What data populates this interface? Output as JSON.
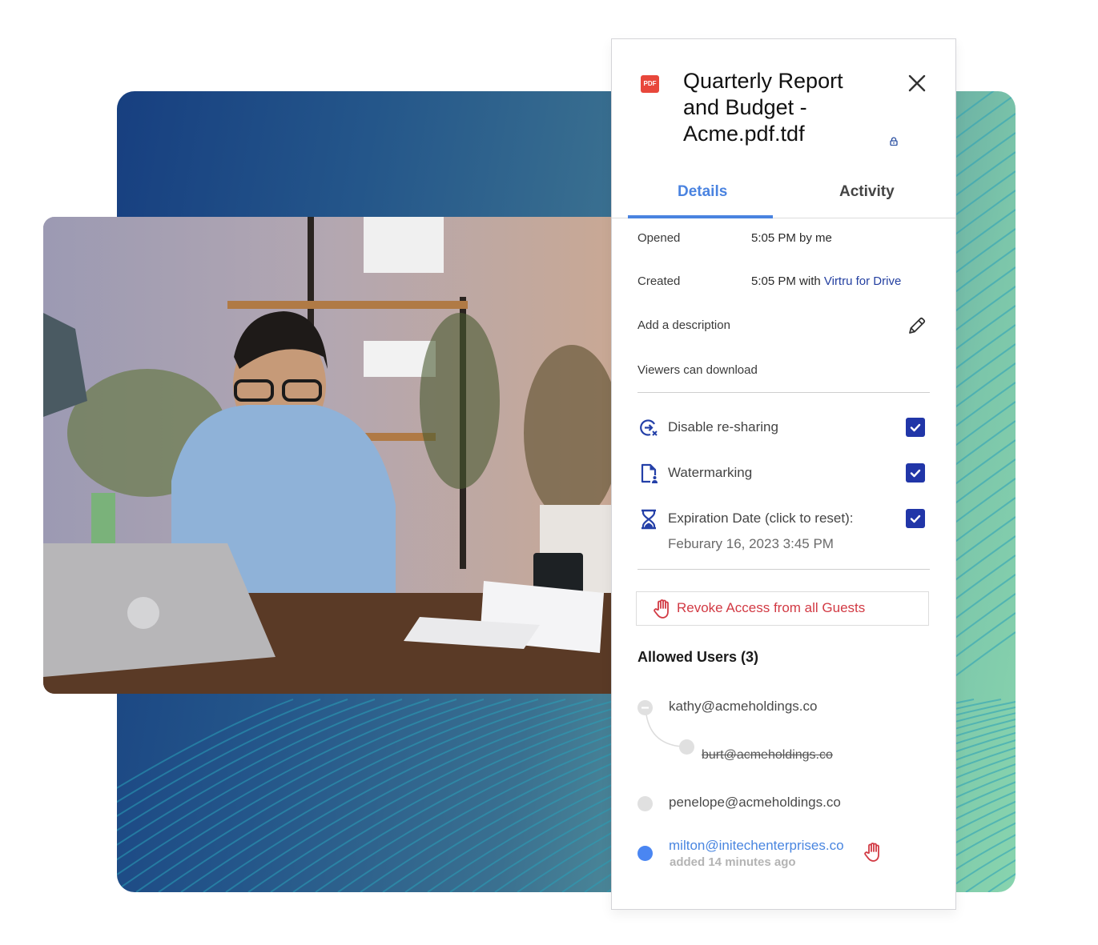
{
  "panel": {
    "file_type_badge": "PDF",
    "title": "Quarterly Report and Budget - Acme.pdf.tdf",
    "close_icon": "close-icon",
    "lock_icon": "lock-icon",
    "tabs": [
      {
        "label": "Details",
        "active": true
      },
      {
        "label": "Activity",
        "active": false
      }
    ],
    "details": {
      "opened_label": "Opened",
      "opened_value": "5:05 PM by me",
      "created_label": "Created",
      "created_value_prefix": "5:05 PM with ",
      "created_value_link": "Virtru for Drive",
      "description_label": "Add a description",
      "viewers_label": "Viewers can download"
    },
    "options": [
      {
        "icon": "disable-resharing-icon",
        "label": "Disable re-sharing",
        "checked": true
      },
      {
        "icon": "watermark-icon",
        "label": "Watermarking",
        "checked": true
      },
      {
        "icon": "hourglass-icon",
        "label": "Expiration Date (click to reset):",
        "checked": true
      }
    ],
    "expiration_date": "Feburary 16, 2023 3:45 PM",
    "revoke_all_label": "Revoke Access from all Guests",
    "allowed_users_title": "Allowed Users (3)",
    "users": [
      {
        "email": "kathy@acmeholdings.co",
        "status": "active"
      },
      {
        "email": "burt@acmeholdings.co",
        "status": "revoked"
      },
      {
        "email": "penelope@acmeholdings.co",
        "status": "active"
      },
      {
        "email": "milton@initechenterprises.co",
        "status": "new",
        "sub": "added 14 minutes ago"
      }
    ]
  },
  "colors": {
    "accent_blue": "#4a83e0",
    "checkbox_navy": "#2136a8",
    "revoke_red": "#d23a44",
    "pdf_red": "#e8473b",
    "link_navy": "#233fa0"
  }
}
